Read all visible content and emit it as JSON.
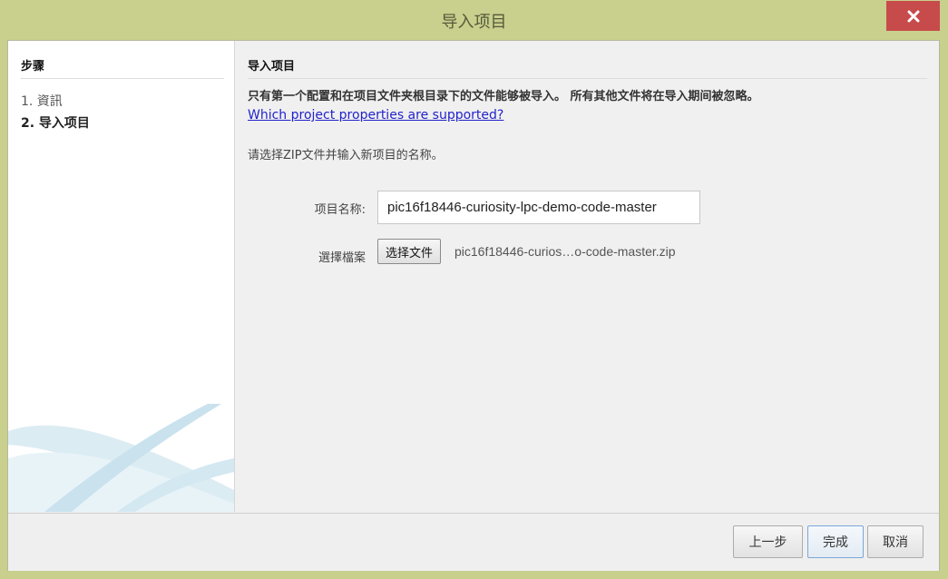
{
  "window": {
    "title": "导入项目",
    "close_icon": "close-icon"
  },
  "steps": {
    "heading": "步骤",
    "items": [
      {
        "label": "1. 資訊",
        "active": false
      },
      {
        "label": "2. 导入项目",
        "active": true
      }
    ]
  },
  "content": {
    "heading": "导入项目",
    "notice": "只有第一个配置和在项目文件夹根目录下的文件能够被导入。 所有其他文件将在导入期间被忽略。",
    "help_link": "Which project properties are supported?",
    "instruction": "请选择ZIP文件并输入新项目的名称。",
    "project_name_label": "项目名称:",
    "project_name_value": "pic16f18446-curiosity-lpc-demo-code-master",
    "file_label": "選擇檔案",
    "choose_file_button": "选择文件",
    "chosen_file": "pic16f18446-curios…o-code-master.zip"
  },
  "footer": {
    "back_button": "上一步",
    "finish_button": "完成",
    "cancel_button": "取消"
  },
  "colors": {
    "title_bar": "#c9cf8d",
    "close_button": "#c74b4b",
    "link": "#2222cc"
  }
}
